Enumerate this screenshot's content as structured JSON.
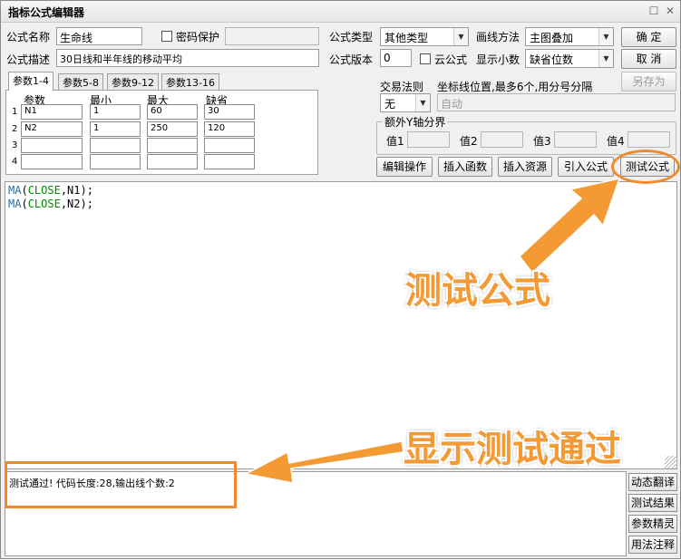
{
  "window": {
    "title": "指标公式编辑器",
    "min_icon": "restore-icon",
    "close_icon": "close-icon"
  },
  "form": {
    "name_label": "公式名称",
    "name_value": "生命线",
    "password_label": "密码保护",
    "type_label": "公式类型",
    "type_value": "其他类型",
    "draw_label": "画线方法",
    "draw_value": "主图叠加",
    "desc_label": "公式描述",
    "desc_value": "30日线和半年线的移动平均",
    "version_label": "公式版本",
    "version_value": "0",
    "cloud_label": "云公式",
    "decimals_label": "显示小数",
    "decimals_value": "缺省位数",
    "ok_label": "确  定",
    "cancel_label": "取  消",
    "saveas_label": "另存为"
  },
  "tabs": [
    {
      "label": "参数1-4"
    },
    {
      "label": "参数5-8"
    },
    {
      "label": "参数9-12"
    },
    {
      "label": "参数13-16"
    }
  ],
  "params": {
    "headers": [
      "参数",
      "最小",
      "最大",
      "缺省"
    ],
    "rows": [
      {
        "num": "1",
        "name": "N1",
        "min": "1",
        "max": "60",
        "default": "30"
      },
      {
        "num": "2",
        "name": "N2",
        "min": "1",
        "max": "250",
        "default": "120"
      },
      {
        "num": "3",
        "name": "",
        "min": "",
        "max": "",
        "default": ""
      },
      {
        "num": "4",
        "name": "",
        "min": "",
        "max": "",
        "default": ""
      }
    ]
  },
  "trade": {
    "rule_label": "交易法则",
    "rule_value": "无",
    "coord_label": "坐标线位置,最多6个,用分号分隔",
    "coord_value": "自动",
    "extra_y_label": "额外Y轴分界",
    "values": [
      "值1",
      "值2",
      "值3",
      "值4"
    ]
  },
  "toolbar": {
    "edit_label": "编辑操作",
    "insert_fn_label": "插入函数",
    "insert_res_label": "插入资源",
    "import_label": "引入公式",
    "test_label": "测试公式"
  },
  "code": {
    "line1": {
      "fn": "MA",
      "open": "(",
      "const": "CLOSE",
      "rest": ",N1);"
    },
    "line2": {
      "fn": "MA",
      "open": "(",
      "const": "CLOSE",
      "rest": ",N2);"
    }
  },
  "output": {
    "text": "测试通过! 代码长度:28,输出线个数:2"
  },
  "side_buttons": [
    "动态翻译",
    "测试结果",
    "参数精灵",
    "用法注释"
  ],
  "annotations": {
    "test_formula": "测试公式",
    "show_pass": "显示测试通过",
    "color": "#f39a35"
  }
}
